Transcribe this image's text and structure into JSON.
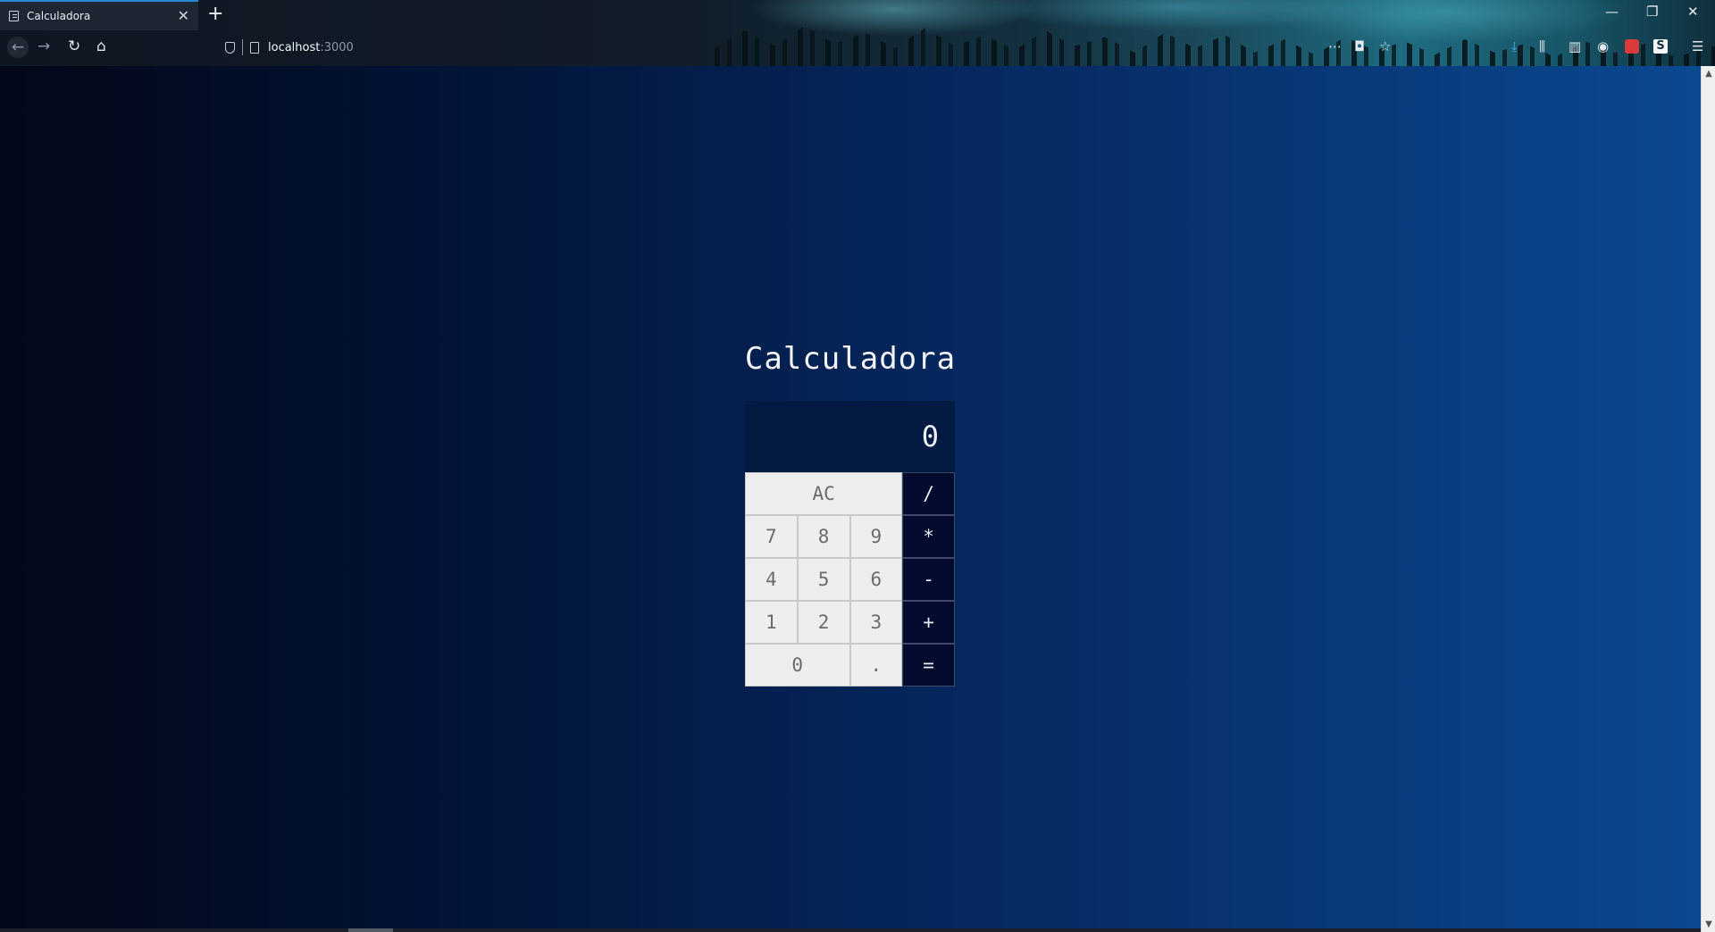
{
  "browser": {
    "tab_title": "Calculadora",
    "tab_close": "✕",
    "new_tab": "+",
    "url_host": "localhost",
    "url_port": ":3000",
    "window_controls": {
      "minimize": "—",
      "restore": "❐",
      "close": "✕"
    },
    "icons": [
      "back-icon",
      "forward-icon",
      "reload-icon",
      "home-icon",
      "tracking-shield-icon",
      "page-info-icon",
      "more-actions-icon",
      "pocket-icon",
      "bookmark-star-icon",
      "downloads-icon",
      "library-icon",
      "sidebar-icon",
      "account-icon",
      "extension-icon",
      "s-extension-icon",
      "menu-icon"
    ]
  },
  "app": {
    "title": "Calculadora",
    "display_value": "0",
    "keys": {
      "clear": "AC",
      "divide": "/",
      "seven": "7",
      "eight": "8",
      "nine": "9",
      "multiply": "*",
      "four": "4",
      "five": "5",
      "six": "6",
      "subtract": "-",
      "one": "1",
      "two": "2",
      "three": "3",
      "add": "+",
      "zero": "0",
      "decimal": ".",
      "equals": "="
    }
  },
  "colors": {
    "display_bg": "#031a43",
    "digit_key_bg": "#eeeeee",
    "operator_key_bg": "#020a2e",
    "page_gradient_start": "#020817",
    "page_gradient_end": "#0b4891"
  }
}
